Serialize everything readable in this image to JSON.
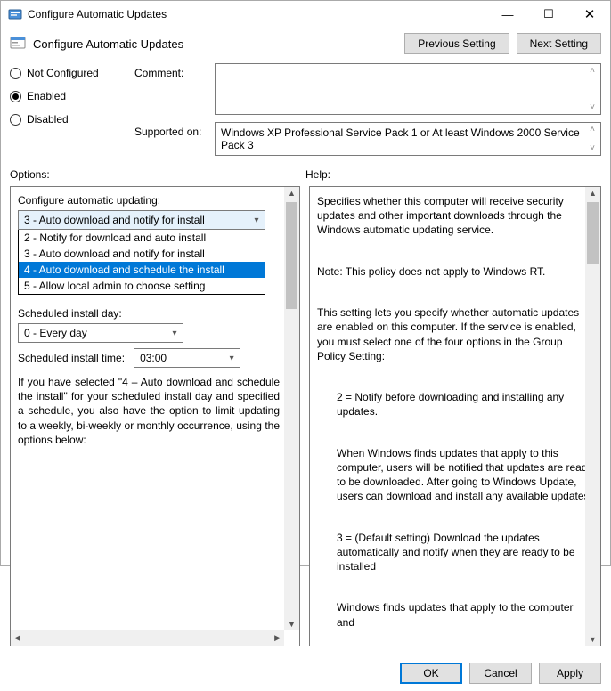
{
  "window": {
    "title": "Configure Automatic Updates"
  },
  "header": {
    "title": "Configure Automatic Updates",
    "prev_btn": "Previous Setting",
    "next_btn": "Next Setting"
  },
  "state": {
    "not_configured": "Not Configured",
    "enabled": "Enabled",
    "disabled": "Disabled",
    "selected": "enabled"
  },
  "meta": {
    "comment_label": "Comment:",
    "comment_value": "",
    "supported_label": "Supported on:",
    "supported_value": "Windows XP Professional Service Pack 1 or At least Windows 2000 Service Pack 3"
  },
  "section_labels": {
    "options": "Options:",
    "help": "Help:"
  },
  "options": {
    "configure_label": "Configure automatic updating:",
    "configure_value": "3 - Auto download and notify for install",
    "dropdown_items": [
      "2 - Notify for download and auto install",
      "3 - Auto download and notify for install",
      "4 - Auto download and schedule the install",
      "5 - Allow local admin to choose setting"
    ],
    "dropdown_highlight_index": 2,
    "sched_day_label": "Scheduled install day:",
    "sched_day_value": "0 - Every day",
    "sched_time_label": "Scheduled install time:",
    "sched_time_value": "03:00",
    "note": "If you have selected \"4 – Auto download and schedule the install\" for your scheduled install day and specified a schedule, you also have the option to limit updating to a weekly, bi-weekly or monthly occurrence, using the options below:"
  },
  "help": {
    "p1": "Specifies whether this computer will receive security updates and other important downloads through the Windows automatic updating service.",
    "p2": "Note: This policy does not apply to Windows RT.",
    "p3": "This setting lets you specify whether automatic updates are enabled on this computer. If the service is enabled, you must select one of the four options in the Group Policy Setting:",
    "p4": "2 = Notify before downloading and installing any updates.",
    "p5": "When Windows finds updates that apply to this computer, users will be notified that updates are ready to be downloaded. After going to Windows Update, users can download and install any available updates.",
    "p6": "3 = (Default setting) Download the updates automatically and notify when they are ready to be installed",
    "p7": "Windows finds updates that apply to the computer and"
  },
  "footer": {
    "ok": "OK",
    "cancel": "Cancel",
    "apply": "Apply"
  }
}
